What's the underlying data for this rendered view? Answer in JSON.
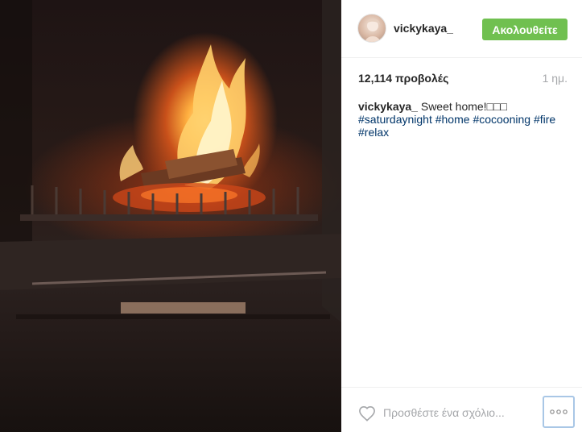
{
  "post": {
    "media": {
      "alt": ""
    },
    "header": {
      "username": "vickykaya_",
      "follow_label": "Ακολουθείτε"
    },
    "stats": {
      "views": "12,114 προβολές",
      "time": "1 ημ."
    },
    "caption": {
      "user": "vickykaya_",
      "text": " Sweet home!□□□",
      "tags": [
        "#saturdaynight",
        "#home",
        "#cocooning",
        "#fire",
        "#relax"
      ]
    },
    "footer": {
      "comment_placeholder": "Προσθέστε ένα σχόλιο..."
    }
  },
  "colors": {
    "follow_button": "#70c050",
    "hashtag": "#003569",
    "muted_text": "#a5a7aa",
    "more_button_border": "#a9c7e6"
  },
  "icons": {
    "like": "heart-outline-icon",
    "more": "ellipsis-icon"
  }
}
